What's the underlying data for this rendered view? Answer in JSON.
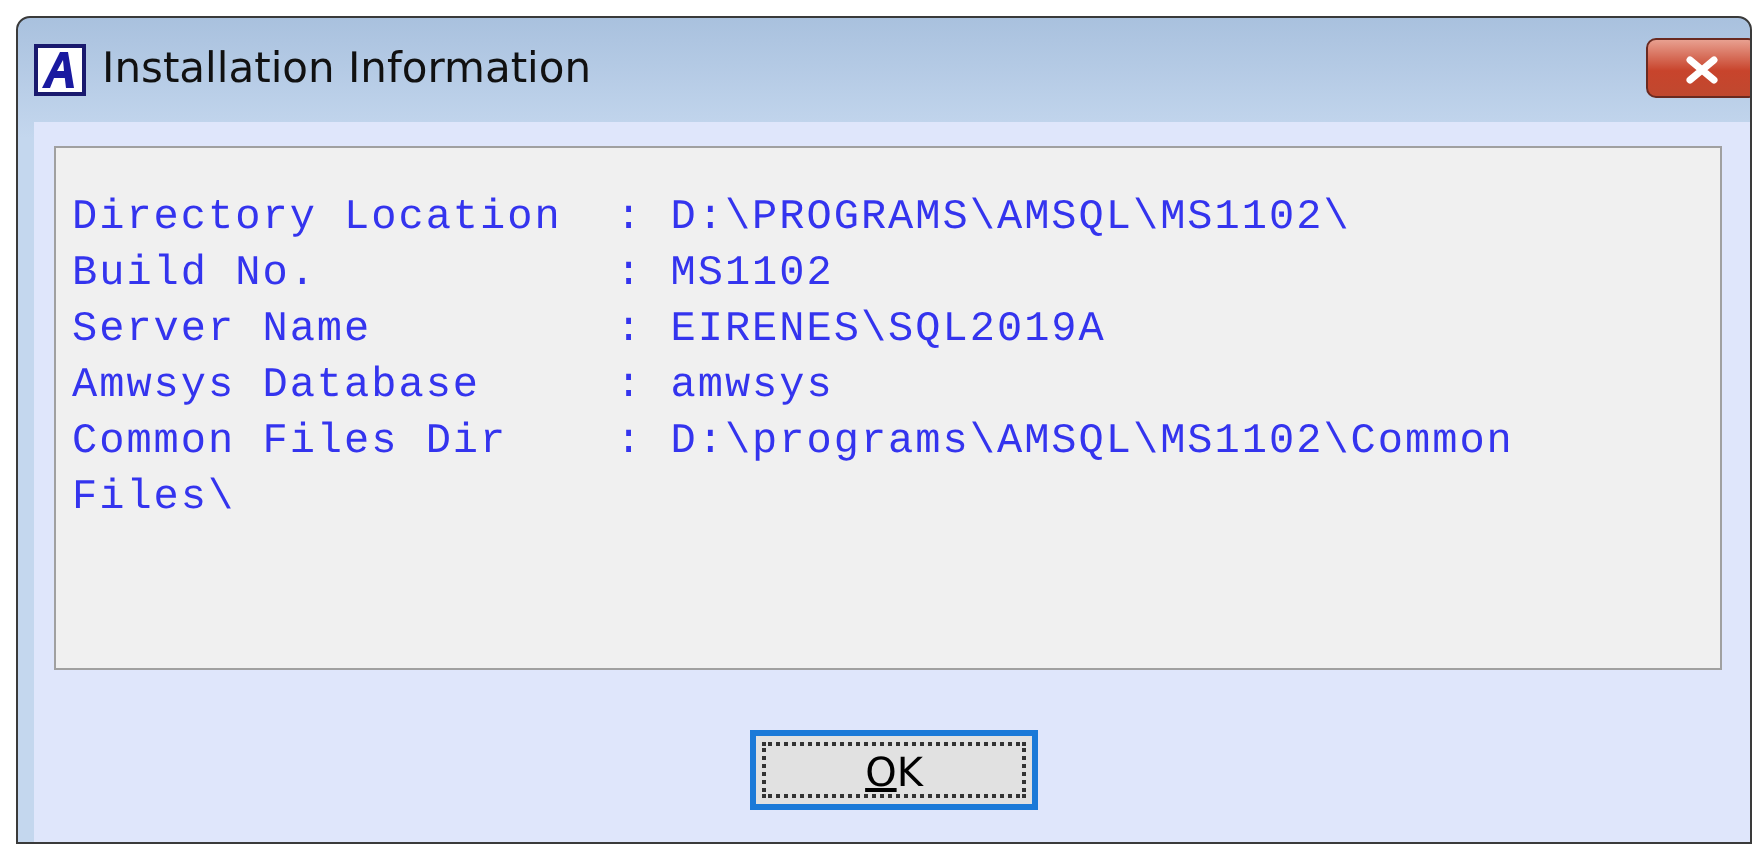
{
  "window": {
    "title": "Installation Information"
  },
  "info_lines": [
    "Directory Location  : D:\\PROGRAMS\\AMSQL\\MS1102\\",
    "Build No.           : MS1102",
    "Server Name         : EIRENES\\SQL2019A",
    "Amwsys Database     : amwsys",
    "Common Files Dir    : D:\\programs\\AMSQL\\MS1102\\Common Files\\"
  ],
  "buttons": [
    {
      "label_parts": [
        {
          "text": "O",
          "underlined": true
        },
        {
          "text": "K",
          "underlined": false
        }
      ]
    }
  ]
}
